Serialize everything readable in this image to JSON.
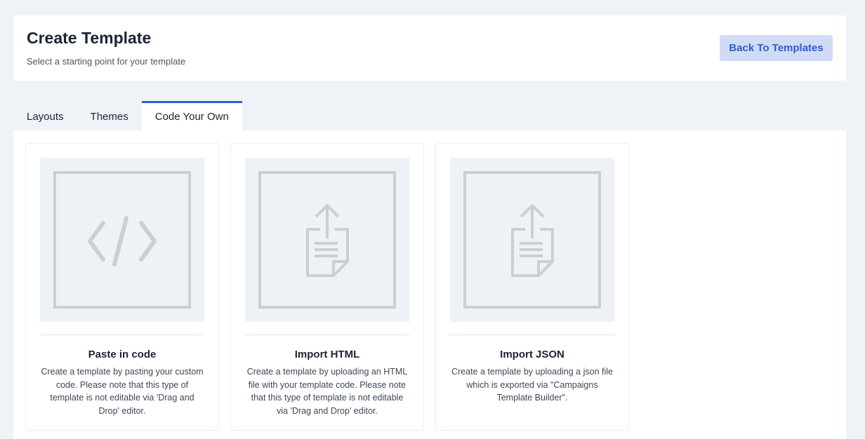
{
  "header": {
    "title": "Create Template",
    "subtitle": "Select a starting point for your template",
    "back_button_label": "Back To Templates"
  },
  "tabs": [
    {
      "label": "Layouts",
      "active": false
    },
    {
      "label": "Themes",
      "active": false
    },
    {
      "label": "Code Your Own",
      "active": true
    }
  ],
  "cards": [
    {
      "icon": "code-icon",
      "title": "Paste in code",
      "description": "Create a template by pasting your custom code. Please note that this type of template is not editable via 'Drag and Drop' editor."
    },
    {
      "icon": "upload-file-icon",
      "title": "Import HTML",
      "description": "Create a template by uploading an HTML file with your template code. Please note that this type of template is not editable via 'Drag and Drop' editor."
    },
    {
      "icon": "upload-file-icon",
      "title": "Import JSON",
      "description": "Create a template by uploading a json file which is exported via \"Campaigns Template Builder\"."
    }
  ],
  "colors": {
    "accent": "#2c5fcf",
    "button_bg": "#d0dcf6",
    "page_bg": "#eff3f8",
    "icon_gray": "#cbced2"
  }
}
